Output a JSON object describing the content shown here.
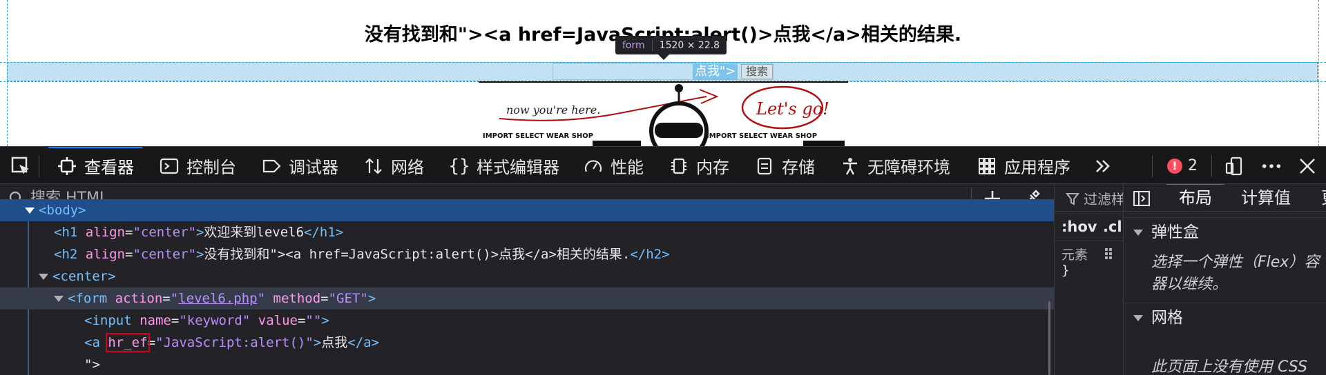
{
  "page": {
    "heading": "没有找到和\">&lt;a href=JavaScript:alert()>点我&lt;/a>相关的结果.",
    "tooltip_tag": "form",
    "tooltip_size": "1520 × 22.8",
    "link_text": "点我\">",
    "search_button": "搜索",
    "banner": {
      "note": "now you're here.",
      "cta": "Let's go!",
      "shop_left": "IMPORT SELECT WEAR SHOP",
      "shop_right": "IMPORT SELECT WEAR SHOP"
    }
  },
  "toolbar": {
    "tabs": [
      {
        "label": "查看器",
        "icon": "inspector-icon"
      },
      {
        "label": "控制台",
        "icon": "console-icon"
      },
      {
        "label": "调试器",
        "icon": "debugger-icon"
      },
      {
        "label": "网络",
        "icon": "network-icon"
      },
      {
        "label": "样式编辑器",
        "icon": "style-editor-icon"
      },
      {
        "label": "性能",
        "icon": "performance-icon"
      },
      {
        "label": "内存",
        "icon": "memory-icon"
      },
      {
        "label": "存储",
        "icon": "storage-icon"
      },
      {
        "label": "无障碍环境",
        "icon": "accessibility-icon"
      },
      {
        "label": "应用程序",
        "icon": "application-icon"
      }
    ],
    "error_count": "2",
    "active_tab": "查看器"
  },
  "markup": {
    "search_placeholder": "搜索 HTML",
    "lines": [
      {
        "tag_open": "<body>",
        "partial": true
      },
      {
        "text": "欢迎来到level6"
      },
      {
        "text": "没有找到和\"><a href=JavaScript:alert()>点我</a>相关的结果."
      },
      {
        "tag": "center"
      },
      {
        "form_action": "level6.php",
        "form_method": "GET"
      },
      {
        "input_name": "keyword",
        "input_value": ""
      },
      {
        "attr_name": "hr_ef",
        "attr_value": "JavaScript:alert()",
        "link_text": "点我"
      },
      {
        "text": "\">"
      }
    ]
  },
  "rules": {
    "filter_placeholder": "过滤样",
    "hov": ":hov",
    "cls": ".cl",
    "element_label": "元素",
    "brace_close": "}"
  },
  "layout_panel": {
    "tabs": [
      "布局",
      "计算值",
      "更"
    ],
    "active_tab": "布局",
    "flexbox_title": "弹性盒",
    "flexbox_note": "选择一个弹性（Flex）容器以继续。",
    "grid_title": "网格",
    "grid_note": "此页面上没有使用 CSS"
  },
  "colors": {
    "toolbar_bg": "#18181a",
    "panel_bg": "#232327",
    "accent": "#0a84ff",
    "tag": "#75bfff",
    "attr_name": "#ff97ed",
    "attr_value": "#b98eff",
    "selection": "#204e8a",
    "error": "#ff4f5e"
  }
}
